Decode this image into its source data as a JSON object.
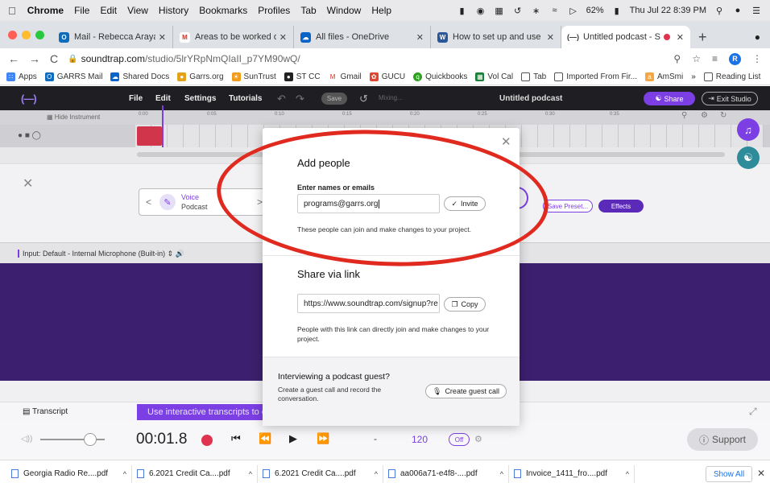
{
  "menubar": {
    "items": [
      "Chrome",
      "File",
      "Edit",
      "View",
      "History",
      "Bookmarks",
      "Profiles",
      "Tab",
      "Window",
      "Help"
    ],
    "battery": "62%",
    "clock": "Thu Jul 22  8:39 PM"
  },
  "tabs": [
    {
      "title": "Mail - Rebecca Arayan - Outlo",
      "favicon": "outlook-icon",
      "color": "#0f6cbd"
    },
    {
      "title": "Areas to be worked on in Faith",
      "favicon": "gmail-icon",
      "color": "#d93025"
    },
    {
      "title": "All files - OneDrive",
      "favicon": "onedrive-icon",
      "color": "#0a64c8"
    },
    {
      "title": "How to set up and use Soundt",
      "favicon": "word-icon",
      "color": "#2b579a"
    },
    {
      "title": "Untitled podcast - Soundt",
      "favicon": "soundtrap-icon",
      "color": "#1f1f23",
      "active": true
    }
  ],
  "address": {
    "domain": "soundtrap.com",
    "path": "/studio/5lrYRpNmQIaII_p7YM90wQ/",
    "profile_initial": "R"
  },
  "bookmarks": {
    "items": [
      {
        "label": "Apps",
        "icon": "apps-grid-icon",
        "color": "#4285f4"
      },
      {
        "label": "GARRS Mail",
        "icon": "outlook-icon",
        "color": "#0f6cbd"
      },
      {
        "label": "Shared Docs",
        "icon": "onedrive-icon",
        "color": "#0a64c8"
      },
      {
        "label": "Garrs.org",
        "icon": "globe-icon",
        "color": "#e3a21a"
      },
      {
        "label": "SunTrust",
        "icon": "sun-icon",
        "color": "#f29b1d"
      },
      {
        "label": "ST CC",
        "icon": "github-icon",
        "color": "#222222"
      },
      {
        "label": "Gmail",
        "icon": "gmail-icon",
        "color": "#d93025"
      },
      {
        "label": "GUCU",
        "icon": "leaf-icon",
        "color": "#e0452f"
      },
      {
        "label": "Quickbooks",
        "icon": "quickbooks-icon",
        "color": "#2ca01c"
      },
      {
        "label": "Vol Cal",
        "icon": "calendar-grid-icon",
        "color": "#188038"
      },
      {
        "label": "Tab",
        "icon": "folder-icon",
        "color": "#555555"
      },
      {
        "label": "Imported From Fir...",
        "icon": "folder-icon",
        "color": "#555555"
      },
      {
        "label": "AmSmi",
        "icon": "amazon-icon",
        "color": "#f3a847"
      }
    ],
    "more": "»",
    "reading_list": "Reading List"
  },
  "app": {
    "logo": "(—)",
    "menu": [
      "File",
      "Edit",
      "Settings",
      "Tutorials"
    ],
    "save": "Save",
    "mixing": "Mixing...",
    "project_title": "Untitled podcast",
    "share": "Share",
    "exit": "Exit Studio",
    "hide_instrument": "Hide Instrument",
    "ticks": [
      "0:00",
      "0:05",
      "0:10",
      "0:15",
      "0:20",
      "0:25",
      "0:30",
      "0:35"
    ],
    "preset_name": "Voice",
    "preset_sub": "Podcast",
    "save_preset": "Save Preset...",
    "effects": "Effects",
    "input_label": "Input: Default - Internal Microphone (Built-in)",
    "transcript": "Transcript",
    "transcript_banner": "Use interactive transcripts to edit",
    "time": "00:01.8",
    "tempo_dash": "-",
    "bpm": "120",
    "metronome": "Off",
    "support": "Support"
  },
  "modal": {
    "add_title": "Add people",
    "names_label": "Enter names or emails",
    "email_value": "programs@garrs.org",
    "invite": "Invite",
    "add_note": "These people can join and make changes to your project.",
    "share_title": "Share via link",
    "link_value": "https://www.soundtrap.com/signup?re",
    "copy": "Copy",
    "link_note": "People with this link can directly join and make changes to your project.",
    "guest_title": "Interviewing a podcast guest?",
    "guest_note": "Create a guest call and record the conversation.",
    "guest_button": "Create guest call"
  },
  "downloads": {
    "items": [
      "Georgia Radio Re....pdf",
      "6.2021 Credit Ca....pdf",
      "6.2021 Credit Ca....pdf",
      "aa006a71-e4f8-....pdf",
      "Invoice_1411_fro....pdf"
    ],
    "show_all": "Show All"
  },
  "colors": {
    "accent": "#7b3fe4",
    "highlight_circle": "#e02a20",
    "record": "#e0334f"
  }
}
